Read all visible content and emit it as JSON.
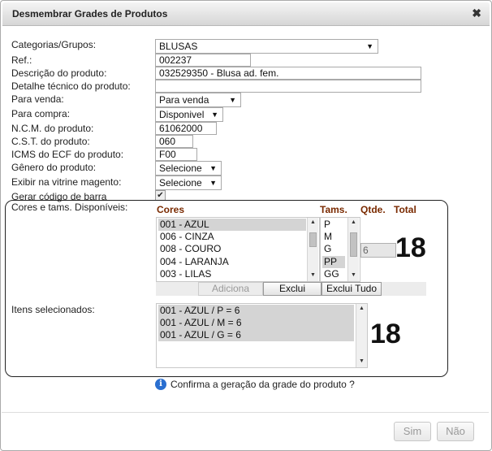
{
  "dialog": {
    "title": "Desmembrar Grades de Produtos",
    "close_glyph": "✖"
  },
  "form": {
    "categorias_label": "Categorias/Grupos:",
    "categorias_value": "BLUSAS",
    "ref_label": "Ref.:",
    "ref_value": "002237",
    "descricao_label": "Descrição do produto:",
    "descricao_value": "032529350 - Blusa ad. fem.",
    "detalhe_label": "Detalhe técnico do produto:",
    "detalhe_value": "",
    "para_venda_label": "Para venda:",
    "para_venda_value": "Para venda",
    "para_compra_label": "Para compra:",
    "para_compra_value": "Disponivel",
    "ncm_label": "N.C.M. do produto:",
    "ncm_value": "61062000",
    "cst_label": "C.S.T. do produto:",
    "cst_value": "060",
    "icms_label": "ICMS do ECF do produto:",
    "icms_value": "F00",
    "genero_label": "Gênero do produto:",
    "genero_value": "Selecione",
    "vitrine_label": "Exibir na vitrine magento:",
    "vitrine_value": "Selecione",
    "gerar_label": "Gerar código de barra",
    "gerar_checked": true
  },
  "grade": {
    "cores_tams_label": "Cores e tams. Disponíveis:",
    "col_cores": "Cores",
    "col_tams": "Tams.",
    "col_qtde": "Qtde.",
    "col_total": "Total",
    "cores": [
      {
        "label": "001 - AZUL",
        "selected": true
      },
      {
        "label": "006 - CINZA",
        "selected": false
      },
      {
        "label": "008 - COURO",
        "selected": false
      },
      {
        "label": "004 - LARANJA",
        "selected": false
      },
      {
        "label": "003 - LILAS",
        "selected": false
      }
    ],
    "tams": [
      {
        "label": "P",
        "selected": false
      },
      {
        "label": "M",
        "selected": false
      },
      {
        "label": "G",
        "selected": false
      },
      {
        "label": "PP",
        "selected": true
      },
      {
        "label": "GG",
        "selected": false
      }
    ],
    "qtde_value": "6",
    "total_value": "18",
    "btn_adiciona": "Adiciona",
    "btn_exclui": "Exclui",
    "btn_exclui_tudo": "Exclui Tudo",
    "itens_label": "Itens selecionados:",
    "itens": [
      "001 - AZUL / P = 6",
      "001 - AZUL / M = 6",
      "001 - AZUL / G = 6"
    ],
    "itens_total": "18"
  },
  "confirm": {
    "icon": "info-icon",
    "text": "Confirma a geração da grade do produto ?"
  },
  "footer": {
    "sim": "Sim",
    "nao": "Não"
  }
}
